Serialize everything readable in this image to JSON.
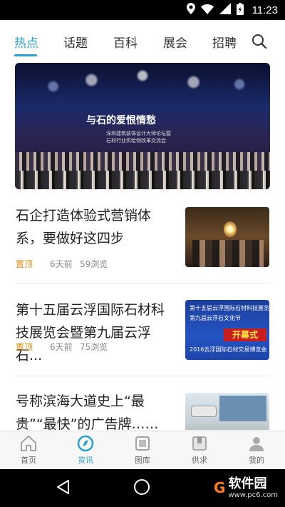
{
  "status_bar": {
    "time": "11:23"
  },
  "top_tabs": [
    {
      "label": "热点",
      "active": true
    },
    {
      "label": "话题",
      "active": false
    },
    {
      "label": "百科",
      "active": false
    },
    {
      "label": "展会",
      "active": false
    },
    {
      "label": "招聘",
      "active": false
    }
  ],
  "banner": {
    "title": "与石的爱恨情愁",
    "line1": "深圳建筑装饰设计大师论坛暨",
    "line2": "石材行业供给侧改革交流会"
  },
  "articles": [
    {
      "title": "石企打造体验式营销体系，要做好这四步",
      "badge": "置顶",
      "time": "6天前",
      "views": "59浏览"
    },
    {
      "title": "第十五届云浮国际石材科技展览会暨第九届云浮石...",
      "badge": "置顶",
      "time": "6天前",
      "views": "75浏览",
      "thumb_text": [
        "第十五届云浮国际石材科技展览会",
        "第九届云浮石文化节",
        "2016云浮国际石材交易博览会"
      ],
      "thumb_banner": "开幕式"
    },
    {
      "title": "号称滨海大道史上“最贵”“最快”的广告牌……被...",
      "badge": "",
      "time": "",
      "views": ""
    }
  ],
  "bottom_nav": [
    {
      "label": "首页",
      "icon": "home-icon",
      "active": false
    },
    {
      "label": "资讯",
      "icon": "news-icon",
      "active": true
    },
    {
      "label": "图库",
      "icon": "gallery-icon",
      "active": false
    },
    {
      "label": "供求",
      "icon": "supply-icon",
      "active": false
    },
    {
      "label": "我的",
      "icon": "profile-icon",
      "active": false
    }
  ],
  "watermark": {
    "name": "软件园",
    "url": "www.pc6.com"
  },
  "colors": {
    "accent": "#2aa0cf",
    "badge": "#e0901a"
  }
}
